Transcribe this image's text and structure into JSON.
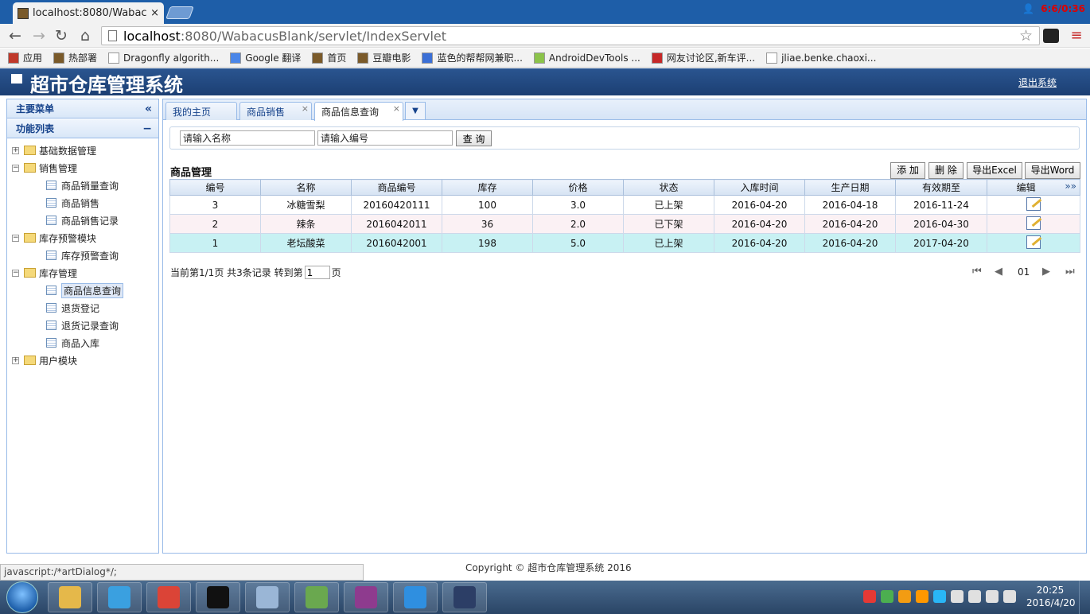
{
  "browser": {
    "tab_title": "localhost:8080/Wabacus",
    "close_tab": "×",
    "overlay_time": "6:6/0:36",
    "url_host": "localhost",
    "url_path": ":8080/WabacusBlank/servlet/IndexServlet",
    "bookmarks": [
      {
        "label": "应用",
        "icon": "apps-icon",
        "color": "#c0392b"
      },
      {
        "label": "热部署",
        "icon": "bookmark-image-icon",
        "color": "#7a5a2a"
      },
      {
        "label": "Dragonfly algorith...",
        "icon": "page-icon",
        "color": "#ffffff"
      },
      {
        "label": "Google 翻译",
        "icon": "google-translate-icon",
        "color": "#4a86e8"
      },
      {
        "label": "首页",
        "icon": "bookmark-image-icon",
        "color": "#7a5a2a"
      },
      {
        "label": "豆瓣电影",
        "icon": "bookmark-image-icon",
        "color": "#7a5a2a"
      },
      {
        "label": "蓝色的帮帮网兼职...",
        "icon": "bracket-icon",
        "color": "#3b6fd6"
      },
      {
        "label": "AndroidDevTools ...",
        "icon": "android-icon",
        "color": "#8bc34a"
      },
      {
        "label": "网友讨论区,新车评...",
        "icon": "forum-icon",
        "color": "#c62828"
      },
      {
        "label": "jliae.benke.chaoxi...",
        "icon": "page-icon",
        "color": "#ffffff"
      }
    ]
  },
  "app": {
    "title": "超市仓库管理系统",
    "logout": "退出系统",
    "copyright": "Copyright © 超市仓库管理系统 2016",
    "status_text": "javascript:/*artDialog*/;"
  },
  "sidebar": {
    "main_menu": "主要菜单",
    "main_menu_ctl": "«",
    "function_list": "功能列表",
    "function_list_ctl": "−",
    "tree": [
      {
        "label": "基础数据管理",
        "type": "folder",
        "expander": "+"
      },
      {
        "label": "销售管理",
        "type": "folder",
        "expander": "−"
      },
      {
        "label": "商品销量查询",
        "type": "leaf"
      },
      {
        "label": "商品销售",
        "type": "leaf"
      },
      {
        "label": "商品销售记录",
        "type": "leaf"
      },
      {
        "label": "库存预警模块",
        "type": "folder",
        "expander": "−"
      },
      {
        "label": "库存预警查询",
        "type": "leaf"
      },
      {
        "label": "库存管理",
        "type": "folder",
        "expander": "−"
      },
      {
        "label": "商品信息查询",
        "type": "leaf",
        "selected": true
      },
      {
        "label": "退货登记",
        "type": "leaf"
      },
      {
        "label": "退货记录查询",
        "type": "leaf"
      },
      {
        "label": "商品入库",
        "type": "leaf"
      },
      {
        "label": "用户模块",
        "type": "folder",
        "expander": "+"
      }
    ]
  },
  "tabs": [
    {
      "label": "我的主页",
      "closable": false
    },
    {
      "label": "商品销售",
      "closable": true
    },
    {
      "label": "商品信息查询",
      "closable": true,
      "active": true
    }
  ],
  "tab_close": "×",
  "tab_menu": "▼",
  "search": {
    "name_placeholder": "请输入名称",
    "code_placeholder": "请输入编号",
    "button": "查 询"
  },
  "grid": {
    "title": "商品管理",
    "buttons": {
      "add": "添 加",
      "delete": "删 除",
      "export_excel": "导出Excel",
      "export_word": "导出Word"
    },
    "columns": [
      "编号",
      "名称",
      "商品编号",
      "库存",
      "价格",
      "状态",
      "入库时间",
      "生产日期",
      "有效期至",
      "编辑"
    ],
    "expand_glyph": "»»",
    "rows": [
      [
        "3",
        "冰糖雪梨",
        "2016042011​1",
        "100",
        "3.0",
        "已上架",
        "2016-04-20",
        "2016-04-18",
        "2016-11-24"
      ],
      [
        "2",
        "辣条",
        "2016042011",
        "36",
        "2.0",
        "已下架",
        "2016-04-20",
        "2016-04-20",
        "2016-04-30"
      ],
      [
        "1",
        "老坛酸菜",
        "2016042001",
        "198",
        "5.0",
        "已上架",
        "2016-04-20",
        "2016-04-20",
        "2017-04-20"
      ]
    ]
  },
  "pagination": {
    "summary": "当前第1/1页 共3条记录 转到第",
    "goto_value": "1",
    "suffix": "页",
    "page": "01",
    "first": "⏮",
    "prev": "◀",
    "next": "▶",
    "last": "⏭"
  },
  "taskbar": {
    "time": "20:25",
    "date": "2016/4/20",
    "apps": [
      {
        "icon": "file-explorer-icon",
        "color": "#e5b84a"
      },
      {
        "icon": "ie-icon",
        "color": "#3aa0e0"
      },
      {
        "icon": "chrome-icon",
        "color": "#db4437"
      },
      {
        "icon": "cmd-icon",
        "color": "#111111"
      },
      {
        "icon": "notepad-icon",
        "color": "#9ab6d6"
      },
      {
        "icon": "editor-icon",
        "color": "#6aa84f"
      },
      {
        "icon": "winrar-icon",
        "color": "#8e3b8e"
      },
      {
        "icon": "wps-icon",
        "color": "#2f8fe0"
      },
      {
        "icon": "eclipse-icon",
        "color": "#2c3e66"
      }
    ],
    "tray": [
      {
        "icon": "weibo-icon",
        "color": "#e53935"
      },
      {
        "icon": "tray-app-icon",
        "color": "#4caf50"
      },
      {
        "icon": "tray-tool-icon",
        "color": "#f39c12"
      },
      {
        "icon": "tray-search-icon",
        "color": "#ff9800"
      },
      {
        "icon": "tray-ring-icon",
        "color": "#29b6f6"
      },
      {
        "icon": "tray-flag-icon",
        "color": "#e0e0e0"
      },
      {
        "icon": "tray-device-icon",
        "color": "#e0e0e0"
      },
      {
        "icon": "network-icon",
        "color": "#e0e0e0"
      },
      {
        "icon": "volume-icon",
        "color": "#e0e0e0"
      }
    ]
  }
}
